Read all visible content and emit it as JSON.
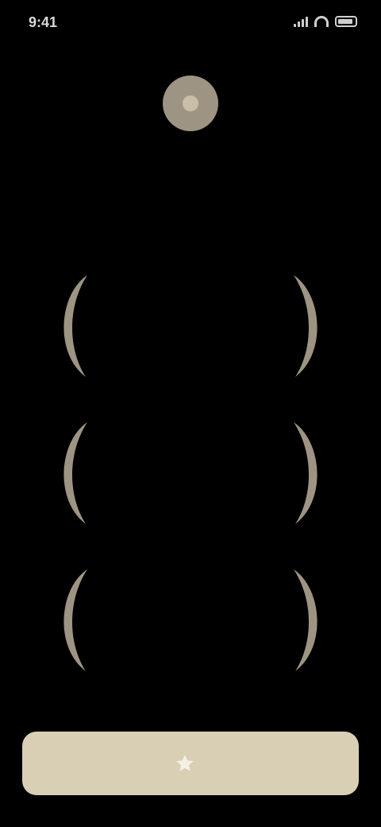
{
  "status_bar": {
    "time": "9:41"
  },
  "header": {
    "logo_icon": "app-logo-icon",
    "title": "",
    "subtitle": ""
  },
  "awards": [
    {
      "title": "",
      "subtitle": ""
    },
    {
      "title": "",
      "subtitle": ""
    },
    {
      "title": "",
      "subtitle": ""
    }
  ],
  "cta": {
    "label": "",
    "icon": "star-icon"
  },
  "colors": {
    "background": "#000000",
    "accent": "#d8cfb5",
    "laurel": "#9e9483"
  }
}
